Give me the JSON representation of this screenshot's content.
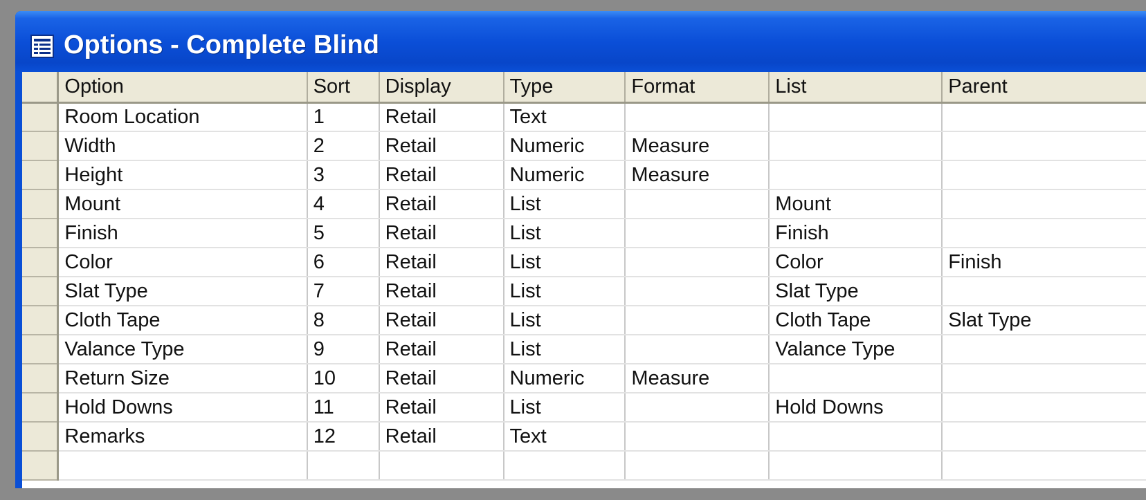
{
  "window": {
    "title": "Options - Complete Blind"
  },
  "table": {
    "columns": [
      "Option",
      "Sort",
      "Display",
      "Type",
      "Format",
      "List",
      "Parent"
    ],
    "rows": [
      [
        "Room Location",
        "1",
        "Retail",
        "Text",
        "",
        "",
        ""
      ],
      [
        "Width",
        "2",
        "Retail",
        "Numeric",
        "Measure",
        "",
        ""
      ],
      [
        "Height",
        "3",
        "Retail",
        "Numeric",
        "Measure",
        "",
        ""
      ],
      [
        "Mount",
        "4",
        "Retail",
        "List",
        "",
        "Mount",
        ""
      ],
      [
        "Finish",
        "5",
        "Retail",
        "List",
        "",
        "Finish",
        ""
      ],
      [
        "Color",
        "6",
        "Retail",
        "List",
        "",
        "Color",
        "Finish"
      ],
      [
        "Slat Type",
        "7",
        "Retail",
        "List",
        "",
        "Slat Type",
        ""
      ],
      [
        "Cloth Tape",
        "8",
        "Retail",
        "List",
        "",
        "Cloth Tape",
        "Slat Type"
      ],
      [
        "Valance Type",
        "9",
        "Retail",
        "List",
        "",
        "Valance Type",
        ""
      ],
      [
        "Return Size",
        "10",
        "Retail",
        "Numeric",
        "Measure",
        "",
        ""
      ],
      [
        "Hold Downs",
        "11",
        "Retail",
        "List",
        "",
        "Hold Downs",
        ""
      ],
      [
        "Remarks",
        "12",
        "Retail",
        "Text",
        "",
        "",
        ""
      ],
      [
        "",
        "",
        "",
        "",
        "",
        "",
        ""
      ]
    ]
  },
  "colors": {
    "title_bar": "#0a4fd6",
    "header_bg": "#ece9d8",
    "grid_line": "#c8c8c8"
  },
  "icons": {
    "title": "datasheet-icon"
  }
}
